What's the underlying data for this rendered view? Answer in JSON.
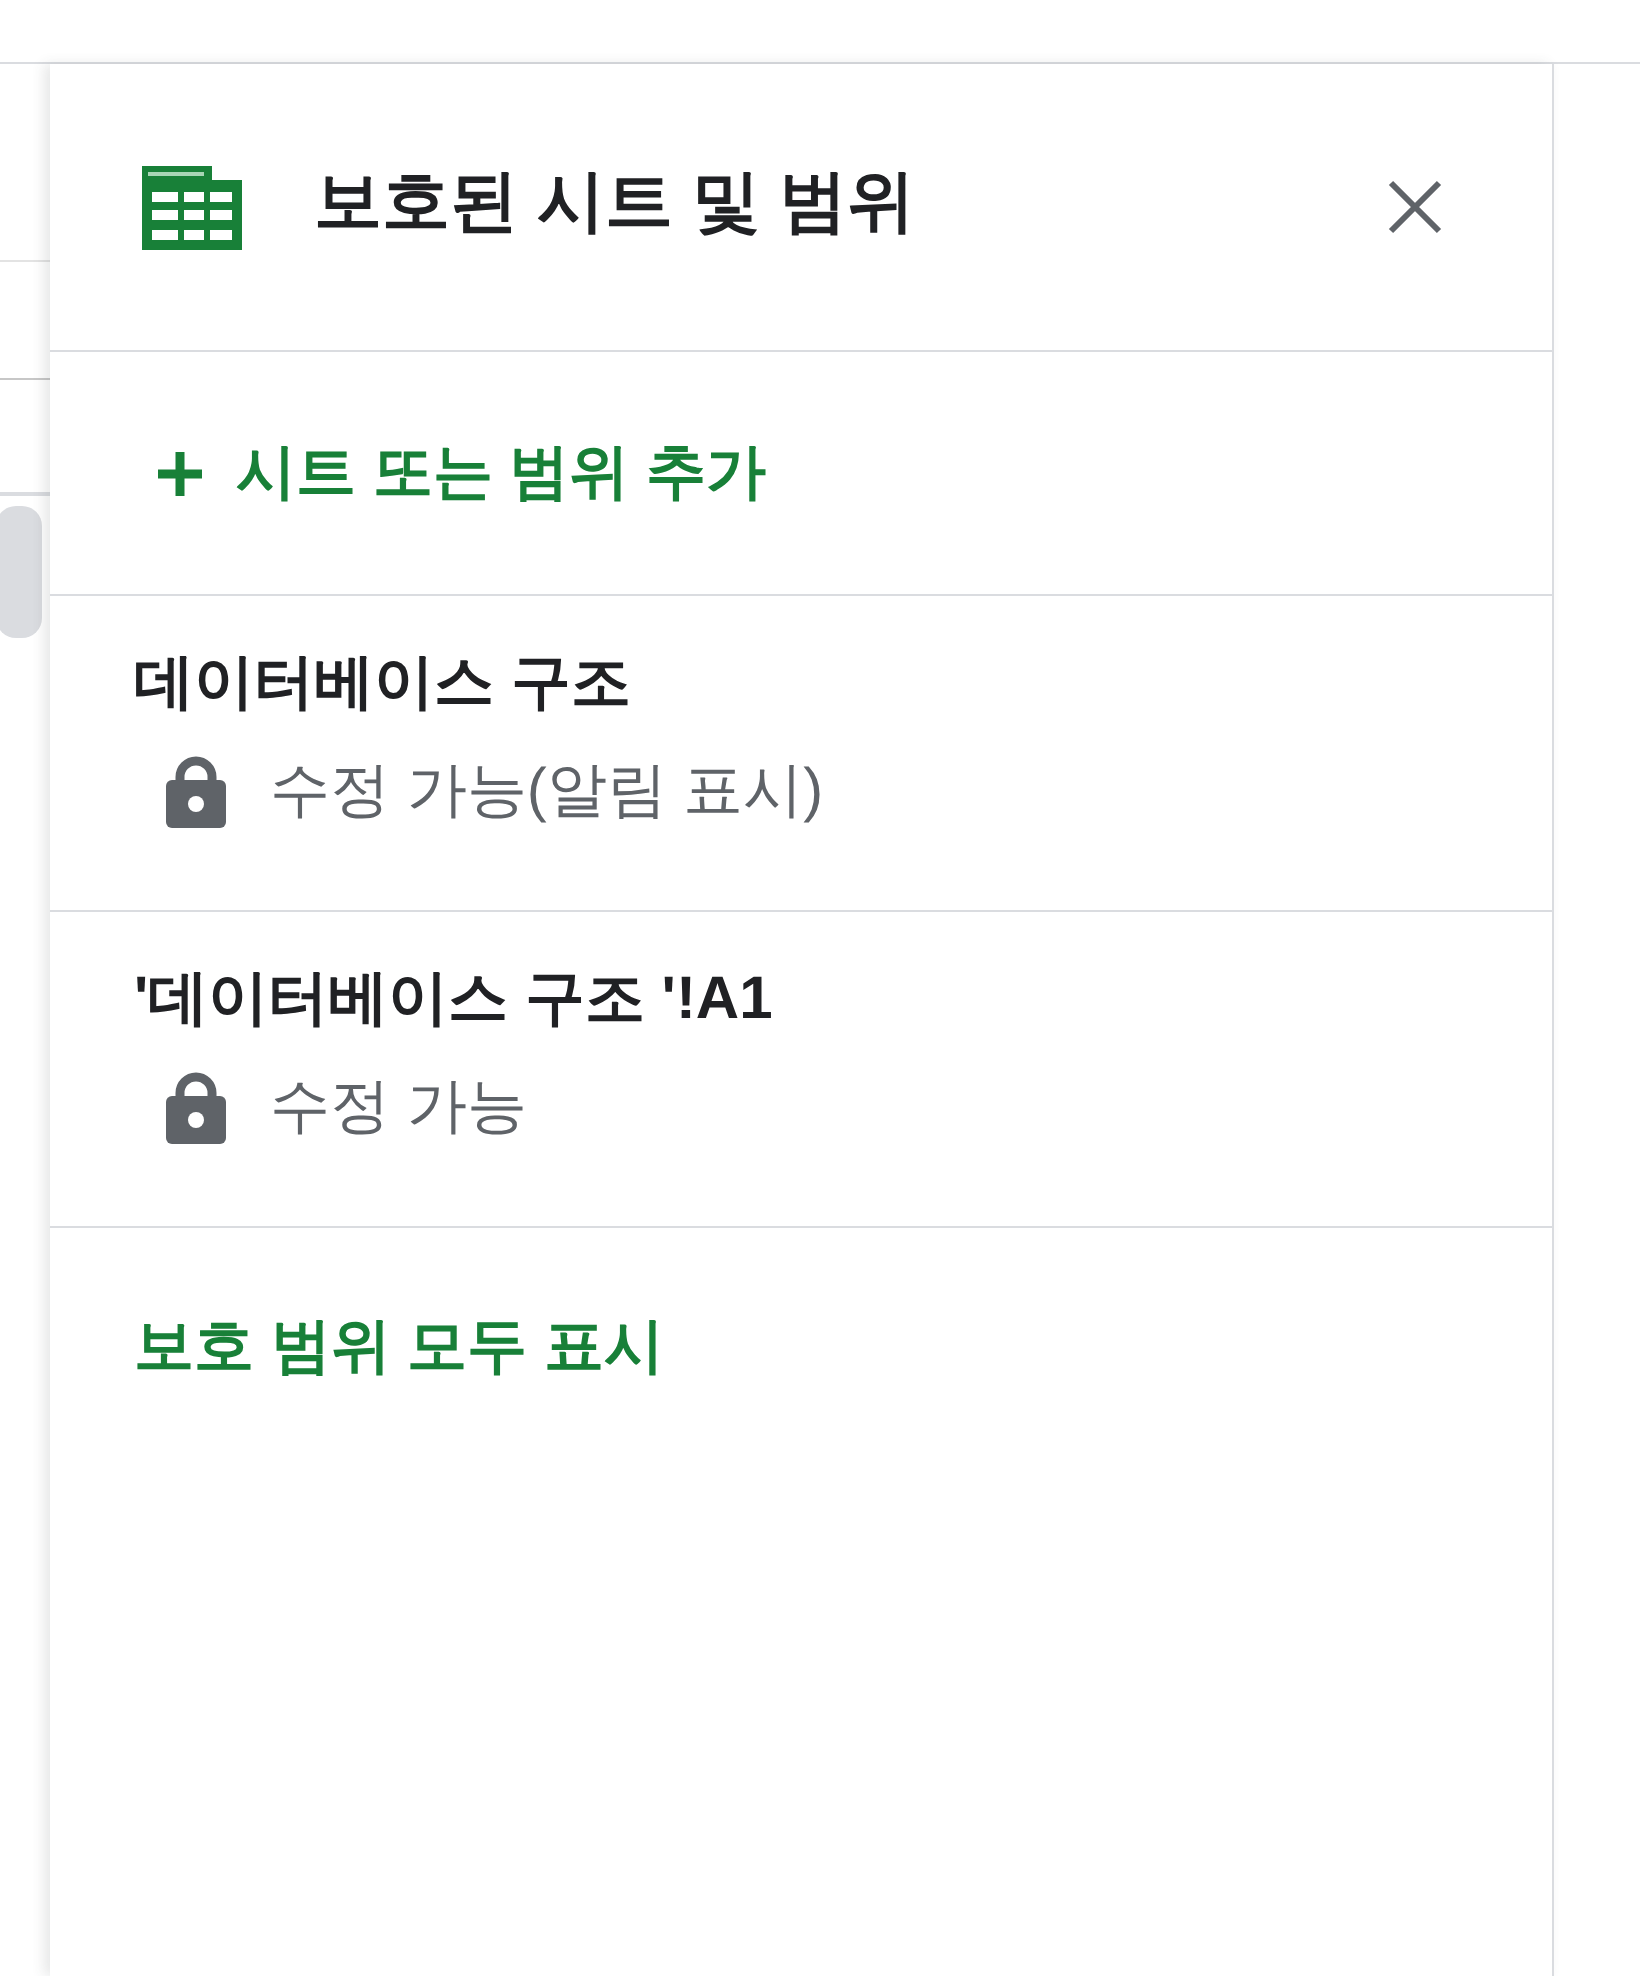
{
  "panel": {
    "title": "보호된 시트 및 범위",
    "add_button": {
      "label": "시트 또는 범위 추가"
    },
    "protected_ranges": [
      {
        "name": "데이터베이스 구조",
        "permission": "수정 가능(알림 표시)"
      },
      {
        "name": "'데이터베이스 구조 '!A1",
        "permission": "수정 가능"
      }
    ],
    "show_all_link": {
      "label": "보호 범위 모두 표시"
    }
  }
}
